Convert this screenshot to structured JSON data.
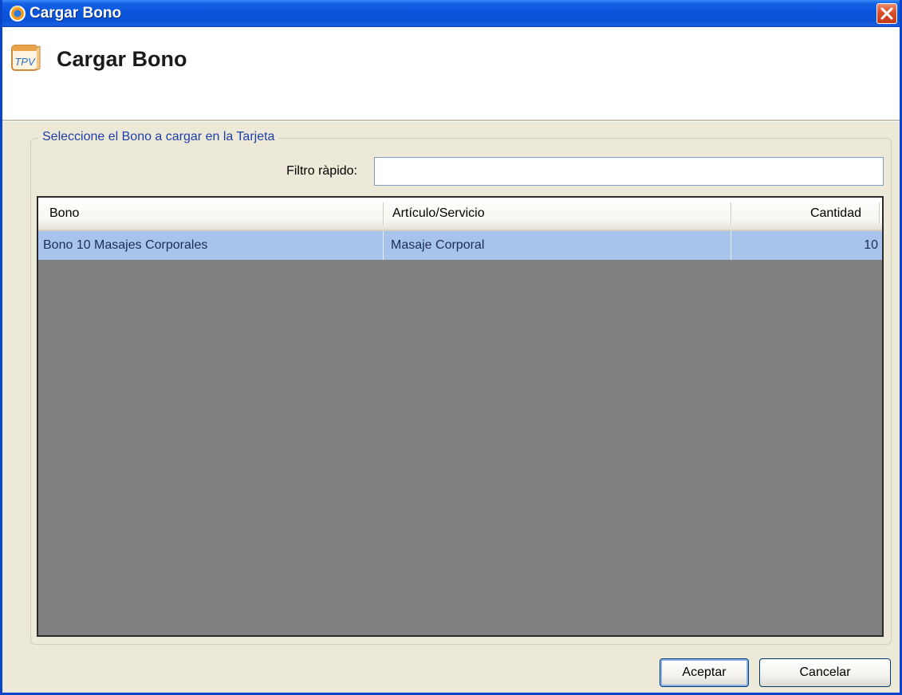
{
  "window": {
    "title": "Cargar Bono",
    "app_icon": "app-logo-icon",
    "close_icon": "close-icon"
  },
  "header": {
    "icon": "tpv-logo-icon",
    "icon_text": "TPV",
    "title": "Cargar Bono"
  },
  "group": {
    "legend": "Seleccione el Bono a cargar en la Tarjeta"
  },
  "filter": {
    "label": "Filtro ràpido:",
    "value": "",
    "placeholder": ""
  },
  "grid": {
    "columns": [
      "Bono",
      "Artículo/Servicio",
      "Cantidad"
    ],
    "rows": [
      {
        "bono": "Bono 10 Masajes Corporales",
        "articulo": "Masaje Corporal",
        "cantidad": "10"
      }
    ],
    "selected_row_color": "#a9c4ec",
    "empty_background": "#808080"
  },
  "buttons": {
    "accept": "Aceptar",
    "cancel": "Cancelar"
  },
  "colors": {
    "titlebar": "#0a55dc",
    "close": "#d94f2b",
    "legend_text": "#1f3ea8",
    "dialog_bg": "#ece9d8"
  }
}
